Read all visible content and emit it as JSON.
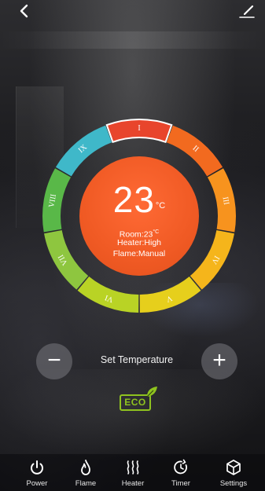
{
  "top_bar": {
    "back_icon": "chevron-left-icon",
    "edit_icon": "pencil-icon"
  },
  "dial": {
    "segments": [
      {
        "numeral": "I",
        "color": "#e8452c",
        "selected": true
      },
      {
        "numeral": "II",
        "color": "#f26a1f"
      },
      {
        "numeral": "III",
        "color": "#f7931e"
      },
      {
        "numeral": "IV",
        "color": "#f5b51b"
      },
      {
        "numeral": "V",
        "color": "#e6cf1c"
      },
      {
        "numeral": "VI",
        "color": "#b9d325"
      },
      {
        "numeral": "VII",
        "color": "#8ec63f"
      },
      {
        "numeral": "VIII",
        "color": "#59b848"
      },
      {
        "numeral": "IX",
        "color": "#3fb8c9"
      }
    ]
  },
  "status": {
    "temperature": "23",
    "temperature_unit": "°C",
    "room_label": "Room:23",
    "room_unit": "°C",
    "heater": "Heater:High",
    "flame": "Flame:Manual"
  },
  "controls": {
    "minus_label": "−",
    "plus_label": "+",
    "set_label": "Set Temperature"
  },
  "eco": {
    "label": "ECO",
    "color": "#8fc31f"
  },
  "nav": [
    {
      "label": "Power",
      "icon": "power-icon"
    },
    {
      "label": "Flame",
      "icon": "flame-icon"
    },
    {
      "label": "Heater",
      "icon": "heat-waves-icon"
    },
    {
      "label": "Timer",
      "icon": "timer-icon"
    },
    {
      "label": "Settings",
      "icon": "settings-cube-icon"
    }
  ]
}
